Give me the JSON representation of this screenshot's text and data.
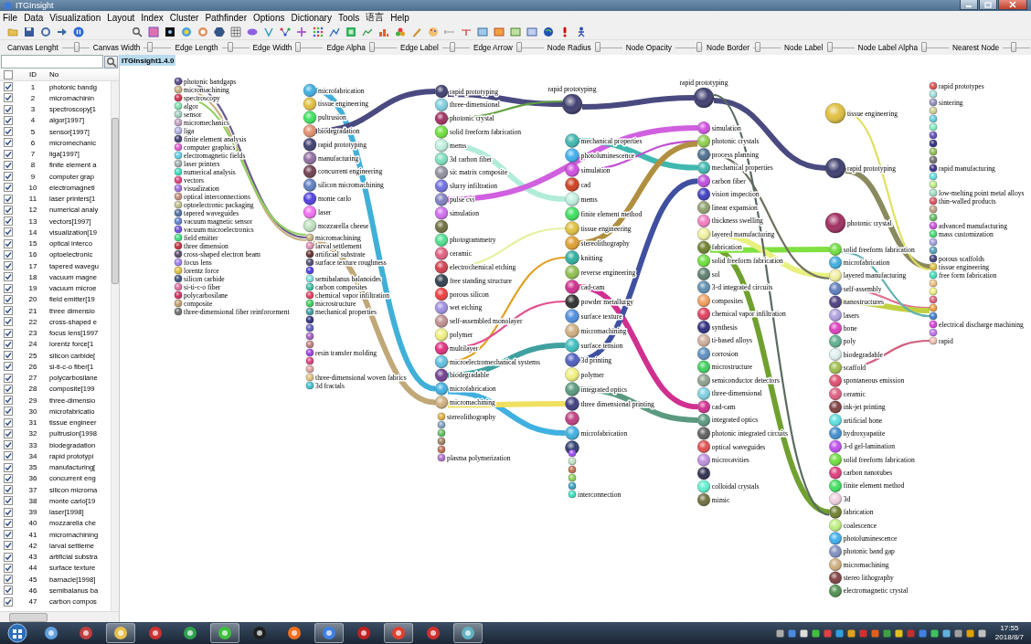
{
  "window": {
    "title": "ITGInsight"
  },
  "menu": [
    "File",
    "Data",
    "Visualization",
    "Layout",
    "Index",
    "Cluster",
    "Pathfinder",
    "Options",
    "Dictionary",
    "Tools",
    "语言",
    "Help"
  ],
  "sliders": [
    {
      "label": "Canvas Lenght",
      "level": 0.55
    },
    {
      "label": "Canvas Width",
      "level": 0.15
    },
    {
      "label": "Edge Length",
      "level": 0.25
    },
    {
      "label": "Edge Width",
      "level": 0.0
    },
    {
      "label": "Edge Alpha",
      "level": 0.0
    },
    {
      "label": "Edge Label",
      "level": 0.35
    },
    {
      "label": "Edge Arrow",
      "level": 0.0
    },
    {
      "label": "Node Radius",
      "level": 0.0
    },
    {
      "label": "Node Opacity",
      "level": 0.95
    },
    {
      "label": "Node Border",
      "level": 0.1
    },
    {
      "label": "Node Label",
      "level": 0.0
    },
    {
      "label": "Node Label Alpha",
      "level": 0.0
    },
    {
      "label": "Nearest Node",
      "level": 0.35
    }
  ],
  "canvas_tab": {
    "label": "ITGInsight1.4.0",
    "selected": true
  },
  "table": {
    "columns": [
      "ID",
      "No"
    ],
    "header_checked": false,
    "rows": [
      {
        "checked": true,
        "id": "1",
        "node": "photonic bandg"
      },
      {
        "checked": true,
        "id": "2",
        "node": "micromachinin"
      },
      {
        "checked": true,
        "id": "3",
        "node": "spectroscopy[1"
      },
      {
        "checked": true,
        "id": "4",
        "node": "algor[1997]"
      },
      {
        "checked": true,
        "id": "5",
        "node": "sensor[1997]"
      },
      {
        "checked": true,
        "id": "6",
        "node": "micromechanic"
      },
      {
        "checked": true,
        "id": "7",
        "node": "liga[1997]"
      },
      {
        "checked": true,
        "id": "8",
        "node": "finite element a"
      },
      {
        "checked": true,
        "id": "9",
        "node": "computer grap"
      },
      {
        "checked": true,
        "id": "10",
        "node": "electromagneti"
      },
      {
        "checked": true,
        "id": "11",
        "node": "laser printers[1"
      },
      {
        "checked": true,
        "id": "12",
        "node": "numerical analy"
      },
      {
        "checked": true,
        "id": "13",
        "node": "vectors[1997]"
      },
      {
        "checked": true,
        "id": "14",
        "node": "visualization[19"
      },
      {
        "checked": true,
        "id": "15",
        "node": "optical interco"
      },
      {
        "checked": true,
        "id": "16",
        "node": "optoelectronic"
      },
      {
        "checked": true,
        "id": "17",
        "node": "tapered wavegu"
      },
      {
        "checked": true,
        "id": "18",
        "node": "vacuum magne"
      },
      {
        "checked": true,
        "id": "19",
        "node": "vacuum microe"
      },
      {
        "checked": true,
        "id": "20",
        "node": "field emitter[19"
      },
      {
        "checked": true,
        "id": "21",
        "node": "three dimensio"
      },
      {
        "checked": true,
        "id": "22",
        "node": "cross-shaped e"
      },
      {
        "checked": true,
        "id": "23",
        "node": "focus lens[1997"
      },
      {
        "checked": true,
        "id": "24",
        "node": "lorentz force[1"
      },
      {
        "checked": true,
        "id": "25",
        "node": "silicon carbide["
      },
      {
        "checked": true,
        "id": "26",
        "node": "si-ti-c-o fiber[1"
      },
      {
        "checked": true,
        "id": "27",
        "node": "polycarbosilane"
      },
      {
        "checked": true,
        "id": "28",
        "node": "composite[199"
      },
      {
        "checked": true,
        "id": "29",
        "node": "three-dimensio"
      },
      {
        "checked": true,
        "id": "30",
        "node": "microfabricatio"
      },
      {
        "checked": true,
        "id": "31",
        "node": "tissue engineer"
      },
      {
        "checked": true,
        "id": "32",
        "node": "pultrusion[1998"
      },
      {
        "checked": true,
        "id": "33",
        "node": "biodegradation"
      },
      {
        "checked": true,
        "id": "34",
        "node": "rapid prototypi"
      },
      {
        "checked": true,
        "id": "35",
        "node": "manufacturing["
      },
      {
        "checked": true,
        "id": "36",
        "node": "concurrent eng"
      },
      {
        "checked": true,
        "id": "37",
        "node": "silicon microma"
      },
      {
        "checked": true,
        "id": "38",
        "node": "monte carlo[19"
      },
      {
        "checked": true,
        "id": "39",
        "node": "laser[1998]"
      },
      {
        "checked": true,
        "id": "40",
        "node": "mozzarella che"
      },
      {
        "checked": true,
        "id": "41",
        "node": "micromachining"
      },
      {
        "checked": true,
        "id": "42",
        "node": "larval settleme"
      },
      {
        "checked": true,
        "id": "43",
        "node": "artificial substra"
      },
      {
        "checked": true,
        "id": "44",
        "node": "surface texture"
      },
      {
        "checked": true,
        "id": "45",
        "node": "barnacle[1998]"
      },
      {
        "checked": true,
        "id": "46",
        "node": "semibalanus ba"
      },
      {
        "checked": true,
        "id": "47",
        "node": "carbon compos"
      }
    ]
  },
  "graph": {
    "groups": [
      {
        "nodes": [
          {
            "label": "photonic bandgaps",
            "color": "#5a4a8a"
          },
          {
            "label": "micromachining",
            "color": "#c8b080"
          },
          {
            "label": "spectroscopy",
            "color": "#d03050"
          },
          {
            "label": "algor",
            "color": "#80e0b0"
          },
          {
            "label": "sensor",
            "color": "#a0d0c0"
          },
          {
            "label": "micromechanics",
            "color": "#c0a0c0"
          },
          {
            "label": "liga",
            "color": "#b0b0e0"
          },
          {
            "label": "finite element analysis",
            "color": "#404070"
          },
          {
            "label": "computer graphics",
            "color": "#e060d0"
          },
          {
            "label": "electromagnetic fields",
            "color": "#60d0e0"
          },
          {
            "label": "laser printers",
            "color": "#a0b0b0"
          },
          {
            "label": "numerical analysis",
            "color": "#40e0c0"
          },
          {
            "label": "vectors",
            "color": "#e04080"
          },
          {
            "label": "visualization",
            "color": "#a070e0"
          },
          {
            "label": "optical interconnections",
            "color": "#c09080"
          },
          {
            "label": "optoelectronic packaging",
            "color": "#c0c090"
          },
          {
            "label": "tapered waveguides",
            "color": "#5070a0"
          },
          {
            "label": "vacuum magnetic sensor",
            "color": "#6080d0"
          },
          {
            "label": "vacuum microelectronics",
            "color": "#7050e0"
          },
          {
            "label": "field emitter",
            "color": "#40e080"
          },
          {
            "label": "three dimension",
            "color": "#c03040"
          },
          {
            "label": "cross-shaped electron beam",
            "color": "#5a4a6a"
          },
          {
            "label": "focus lens",
            "color": "#a080f0"
          },
          {
            "label": "lorentz force",
            "color": "#e0c040"
          },
          {
            "label": "silicon carbide",
            "color": "#405080"
          },
          {
            "label": "si-ti-c-o fiber",
            "color": "#e070a0"
          },
          {
            "label": "polycarbosilane",
            "color": "#d03060"
          },
          {
            "label": "composite",
            "color": "#c0a070"
          },
          {
            "label": "three-dimensional fiber reinforcement",
            "color": "#707070"
          }
        ]
      },
      {
        "nodes": [
          {
            "label": "microfabrication",
            "color": "#40b0e0"
          },
          {
            "label": "tissue engineering",
            "color": "#e0c040"
          },
          {
            "label": "pultrusion",
            "color": "#40e060"
          },
          {
            "label": "biodegradation",
            "color": "#e09070"
          },
          {
            "label": "rapid prototyping",
            "color": "#404070"
          },
          {
            "label": "manufacturing",
            "color": "#9070a0"
          },
          {
            "label": "concurrent engineering",
            "color": "#704050"
          },
          {
            "label": "silicon micromachining",
            "color": "#6080c0"
          },
          {
            "label": "monte carlo",
            "color": "#5040e0"
          },
          {
            "label": "laser",
            "color": "#f070f0"
          },
          {
            "label": "mozzarella cheese",
            "color": "#c0e0c0"
          }
        ]
      },
      {
        "nodes": [
          {
            "label": "micromachining",
            "color": "#c8b080"
          },
          {
            "label": "larval settlement",
            "color": "#e090b0"
          },
          {
            "label": "artificial substrate",
            "color": "#603030"
          },
          {
            "label": "surface texture roughness",
            "color": "#505070"
          },
          {
            "color": "#5040e0"
          },
          {
            "label": "semibalanus balanoides",
            "color": "#80e0e0"
          },
          {
            "label": "carbon composites",
            "color": "#40c0a0"
          },
          {
            "label": "chemical vapor infiltration",
            "color": "#e04060"
          },
          {
            "label": "microstructure",
            "color": "#40d060"
          },
          {
            "label": "mechanical properties",
            "color": "#40a0a0"
          },
          {
            "color": "#303080"
          },
          {
            "color": "#6060c0"
          },
          {
            "color": "#a060c0"
          },
          {
            "color": "#c08080"
          },
          {
            "label": "resin transfer molding",
            "color": "#a040e0"
          },
          {
            "color": "#e04080"
          },
          {
            "color": "#e0a0a0"
          },
          {
            "label": "three-dimensional woven fabrics",
            "color": "#e0c080"
          },
          {
            "label": "3d fractals",
            "color": "#40c0d0"
          }
        ]
      },
      {
        "nodes": [
          {
            "label": "rapid prototyping",
            "color": "#404070"
          },
          {
            "label": "three-dimensional",
            "color": "#80d0e0"
          },
          {
            "label": "photonic crystal",
            "color": "#a03060"
          },
          {
            "label": "solid freeform fabrication",
            "color": "#70e040"
          },
          {
            "label": "mems",
            "color": "#c0f0e0"
          },
          {
            "label": "3d carbon fiber",
            "color": "#80e0c0"
          },
          {
            "label": "sic matrix composite",
            "color": "#9090a0"
          },
          {
            "label": "slurry infiltration",
            "color": "#7070e0"
          },
          {
            "label": "pulse cvi",
            "color": "#8080c0"
          },
          {
            "label": "simulation",
            "color": "#d070f0"
          },
          {
            "color": "#707040"
          },
          {
            "label": "photogrammetry",
            "color": "#50e090"
          },
          {
            "label": "ceramic",
            "color": "#e06080"
          },
          {
            "label": "electrochemical etching",
            "color": "#d04050"
          },
          {
            "label": "free standing structure",
            "color": "#304050"
          },
          {
            "label": "porous silicon",
            "color": "#f04040"
          },
          {
            "label": "wet etching",
            "color": "#a090e0"
          },
          {
            "label": "self-assembled monolayer",
            "color": "#c09090"
          },
          {
            "label": "polymer",
            "color": "#f0f080"
          },
          {
            "label": "multilayer",
            "color": "#e03080"
          },
          {
            "label": "microelectromechanical systems",
            "color": "#60c0e0"
          },
          {
            "label": "biodegradable",
            "color": "#704090"
          },
          {
            "label": "microfabrication",
            "color": "#40b0e0"
          },
          {
            "label": "micromachining",
            "color": "#d0b080"
          }
        ]
      },
      {
        "nodes": [
          {
            "label": "stereolithography",
            "color": "#e0b040"
          },
          {
            "color": "#80a0c0"
          },
          {
            "color": "#60c060"
          },
          {
            "color": "#a08060"
          },
          {
            "color": "#c07050"
          },
          {
            "label": "plasma polymerization",
            "color": "#b070d0"
          }
        ]
      },
      {
        "nodes": [
          {
            "label": "rapid prototyping",
            "color": "#404070"
          }
        ]
      },
      {
        "nodes": [
          {
            "label": "mechanical properties",
            "color": "#40b8b0"
          },
          {
            "label": "photoluminescence",
            "color": "#40b0f0"
          },
          {
            "label": "simulation",
            "color": "#d050e0"
          },
          {
            "label": "cad",
            "color": "#d04020"
          },
          {
            "label": "mems",
            "color": "#c0f0e0"
          },
          {
            "label": "finite element method",
            "color": "#40e060"
          },
          {
            "label": "tissue engineering",
            "color": "#e0c040"
          },
          {
            "label": "stereolithography",
            "color": "#e0a030"
          },
          {
            "label": "knitting",
            "color": "#30b0a0"
          },
          {
            "label": "reverse engineering",
            "color": "#90c050"
          },
          {
            "label": "cad-cam",
            "color": "#d03090"
          },
          {
            "label": "powder metallurgy",
            "color": "#303030"
          },
          {
            "label": "surface texture",
            "color": "#5090e0"
          },
          {
            "label": "micromachining",
            "color": "#d0b080"
          },
          {
            "label": "surface tension",
            "color": "#40c0c0"
          },
          {
            "label": "3d printing",
            "color": "#5060c0"
          },
          {
            "label": "polymer",
            "color": "#f0f080"
          },
          {
            "label": "integrated optics",
            "color": "#5a9a80"
          },
          {
            "label": "three dimensional printing",
            "color": "#404080"
          },
          {
            "color": "#c04080"
          },
          {
            "label": "microfabrication",
            "color": "#40b0e0"
          },
          {
            "color": "#304070"
          }
        ]
      },
      {
        "nodes": [
          {
            "color": "#a050f0"
          },
          {
            "color": "#c0e0c0"
          },
          {
            "color": "#c07050"
          },
          {
            "color": "#90d060"
          },
          {
            "color": "#40a0c0"
          },
          {
            "label": "interconnection",
            "color": "#40e0c0"
          }
        ]
      },
      {
        "nodes": [
          {
            "label": "rapid prototyping",
            "color": "#404070"
          }
        ]
      },
      {
        "nodes": [
          {
            "label": "simulation",
            "color": "#d050e0"
          },
          {
            "label": "photonic crystals",
            "color": "#90d050"
          },
          {
            "label": "process planning",
            "color": "#507090"
          },
          {
            "label": "mechanical properties",
            "color": "#40b8b0"
          },
          {
            "label": "carbon fiber",
            "color": "#c050e0"
          },
          {
            "label": "vision inspection",
            "color": "#4040c0"
          },
          {
            "label": "linear expansion",
            "color": "#90a070"
          },
          {
            "label": "thickness swelling",
            "color": "#f080c0"
          },
          {
            "label": "layered manufacturing",
            "color": "#f0f0a0"
          },
          {
            "label": "fabrication",
            "color": "#708030"
          },
          {
            "label": "solid freeform fabrication",
            "color": "#70e040"
          },
          {
            "label": "sol",
            "color": "#608070"
          },
          {
            "label": "3-d integrated circuits",
            "color": "#6090b0"
          },
          {
            "label": "composites",
            "color": "#f0a060"
          },
          {
            "label": "chemical vapor infiltration",
            "color": "#e04060"
          },
          {
            "label": "synthesis",
            "color": "#303080"
          },
          {
            "label": "ti-based alloys",
            "color": "#d0b0a0"
          },
          {
            "label": "corrosion",
            "color": "#6090c0"
          },
          {
            "label": "microstructure",
            "color": "#40d060"
          },
          {
            "label": "semiconductor detectors",
            "color": "#90a090"
          },
          {
            "label": "three-dimensional",
            "color": "#80d0e0"
          },
          {
            "label": "cad-cam",
            "color": "#d03090"
          },
          {
            "label": "integrated optics",
            "color": "#5a9a80"
          },
          {
            "label": "photonic integrated circuits",
            "color": "#606060"
          },
          {
            "label": "optical waveguides",
            "color": "#e05050"
          },
          {
            "label": "microcavities",
            "color": "#c090e0"
          },
          {
            "color": "#303050"
          },
          {
            "label": "colloidal crystals",
            "color": "#60f0d0"
          },
          {
            "label": "mimic",
            "color": "#707040"
          }
        ]
      },
      {
        "nodes": [
          {
            "label": "tissue engineering",
            "color": "#e0c040"
          },
          {
            "label": "rapid prototyping",
            "color": "#404070"
          },
          {
            "label": "photonic crystal",
            "color": "#a03060"
          }
        ]
      },
      {
        "nodes": [
          {
            "label": "solid freeform fabrication",
            "color": "#70e040"
          },
          {
            "label": "microfabrication",
            "color": "#40b0e0"
          },
          {
            "label": "layered manufacturing",
            "color": "#f0f0a0"
          },
          {
            "label": "self-assembly",
            "color": "#6080c0"
          },
          {
            "label": "nanostructures",
            "color": "#504080"
          },
          {
            "label": "lasers",
            "color": "#b0a0e0"
          },
          {
            "label": "bone",
            "color": "#e040c0"
          },
          {
            "label": "poly",
            "color": "#60b090"
          },
          {
            "label": "biodegradable",
            "color": "#e0f0f0"
          },
          {
            "label": "scaffold",
            "color": "#a0c050"
          },
          {
            "label": "spontaneous emission",
            "color": "#e05070"
          },
          {
            "label": "ceramic",
            "color": "#e06080"
          },
          {
            "label": "ink-jet printing",
            "color": "#804040"
          },
          {
            "label": "artificial bone",
            "color": "#60e0e0"
          },
          {
            "label": "hydroxyapatite",
            "color": "#4090d0"
          },
          {
            "label": "3-d gel-lamination",
            "color": "#c050f0"
          },
          {
            "label": "solid freeform fabrication",
            "color": "#70e040"
          },
          {
            "label": "carbon nanotubes",
            "color": "#e04080"
          },
          {
            "label": "finite element method",
            "color": "#40e060"
          },
          {
            "label": "3d",
            "color": "#f0d0e0"
          },
          {
            "label": "fabrication",
            "color": "#708030"
          },
          {
            "label": "coalescence",
            "color": "#c0f080"
          },
          {
            "label": "photoluminescence",
            "color": "#40b0f0"
          },
          {
            "label": "photonic band gap",
            "color": "#8090c0"
          },
          {
            "label": "micromachining",
            "color": "#d0b080"
          },
          {
            "label": "stereo lithography",
            "color": "#804040"
          },
          {
            "label": "electromagnetic crystal",
            "color": "#509050"
          }
        ]
      },
      {
        "nodes": [
          {
            "label": "rapid prototypes",
            "color": "#e05050"
          },
          {
            "color": "#a0e0e0"
          },
          {
            "label": "sintering",
            "color": "#9090c0"
          },
          {
            "color": "#d0d090"
          },
          {
            "color": "#60d0e0"
          },
          {
            "color": "#80f0c0"
          },
          {
            "color": "#6050c0"
          },
          {
            "color": "#303080"
          },
          {
            "color": "#90c050"
          },
          {
            "color": "#707070"
          },
          {
            "label": "rapid manufacturing",
            "color": "#403090"
          },
          {
            "color": "#60e0e0"
          },
          {
            "color": "#c0f080"
          },
          {
            "label": "low-melting point metal alloys",
            "color": "#a0e0c0"
          },
          {
            "label": "thin-walled products",
            "color": "#e05060"
          },
          {
            "color": "#c0a080"
          },
          {
            "color": "#60c060"
          },
          {
            "label": "advanced manufacturing",
            "color": "#d050e0"
          },
          {
            "label": "mass customization",
            "color": "#40e070"
          },
          {
            "color": "#a0a0e0"
          },
          {
            "color": "#50a0c0"
          },
          {
            "label": "porous scaffolds",
            "color": "#404080"
          },
          {
            "label": "tissue engineering",
            "color": "#e0c040"
          },
          {
            "label": "free form fabrication",
            "color": "#40e0c0"
          },
          {
            "color": "#f0c080"
          },
          {
            "color": "#f0f080"
          },
          {
            "color": "#e06080"
          },
          {
            "color": "#f0a040"
          },
          {
            "color": "#4080d0"
          },
          {
            "label": "electrical discharge machining",
            "color": "#e040e0"
          },
          {
            "color": "#c070f0"
          },
          {
            "label": "rapid",
            "color": "#f0c0b0"
          }
        ]
      }
    ],
    "edges": [
      {
        "color": "#6a5a90"
      },
      {
        "color": "#c8b080"
      },
      {
        "color": "#90d060"
      },
      {
        "color": "#40b0d8"
      },
      {
        "color": "#4a4a80"
      },
      {
        "color": "#4a4a80"
      },
      {
        "color": "#4a4a80"
      },
      {
        "color": "#4a4a80"
      },
      {
        "color": "#8a8a60"
      },
      {
        "color": "#c0a878"
      },
      {
        "color": "#b0ecd8"
      },
      {
        "color": "#d060e0"
      },
      {
        "color": "#40b8b0"
      },
      {
        "color": "#d03090"
      },
      {
        "color": "#5a9a80"
      },
      {
        "color": "#70a030"
      },
      {
        "color": "#80e040"
      },
      {
        "color": "#e8f080"
      },
      {
        "color": "#e0e060"
      },
      {
        "color": "#e07090"
      },
      {
        "color": "#c0d040"
      },
      {
        "color": "#d06080"
      },
      {
        "color": "#60b0b0"
      },
      {
        "color": "#707060"
      },
      {
        "color": "#5a6a60"
      },
      {
        "color": "#e0a020"
      },
      {
        "color": "#40a0a0"
      },
      {
        "color": "#40b0e0"
      },
      {
        "color": "#f0e060"
      },
      {
        "color": "#60a040"
      },
      {
        "color": "#c050d0"
      },
      {
        "color": "#b09040"
      },
      {
        "color": "#4050a0"
      },
      {
        "color": "#e05090"
      },
      {
        "color": "#e8f0a0"
      }
    ]
  },
  "taskbar": {
    "apps": [
      {
        "running": false
      },
      {
        "running": false
      },
      {
        "running": true
      },
      {
        "running": false
      },
      {
        "running": false
      },
      {
        "running": true
      },
      {
        "running": false
      },
      {
        "running": false
      },
      {
        "running": true
      },
      {
        "running": false
      },
      {
        "running": true
      },
      {
        "running": false
      },
      {
        "running": true
      }
    ],
    "time": "17:55",
    "date": "2018/8/7"
  }
}
